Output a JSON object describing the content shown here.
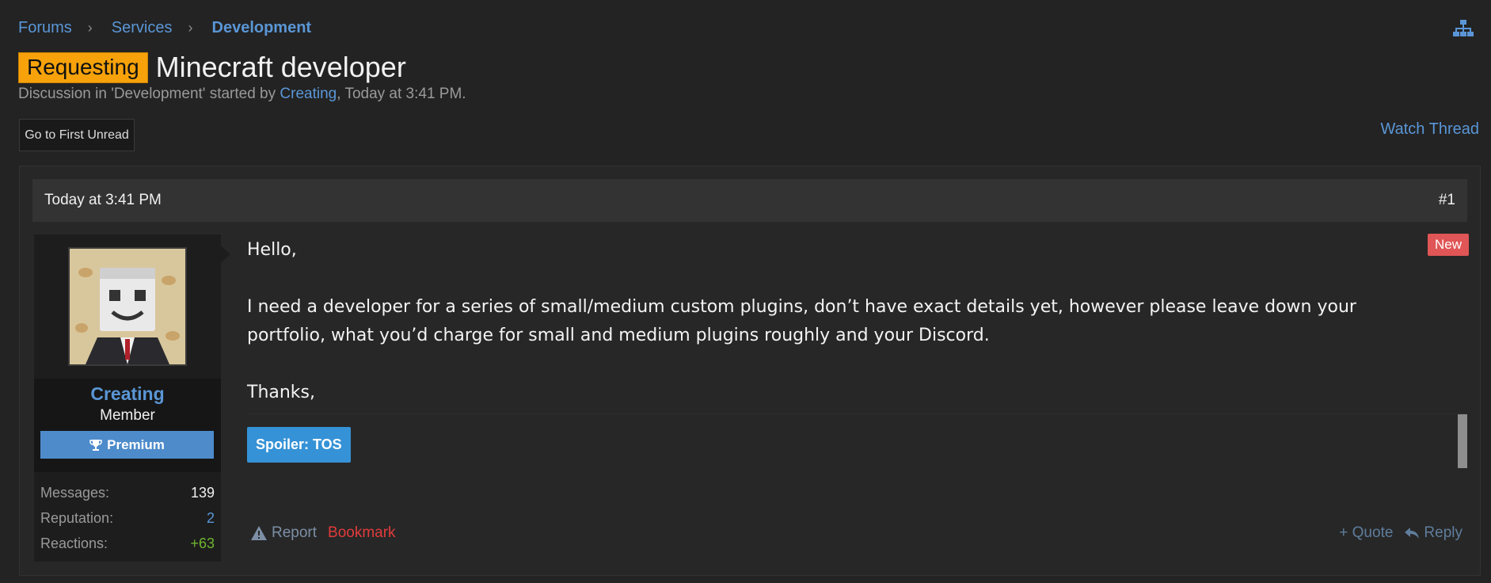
{
  "breadcrumb": {
    "items": [
      "Forums",
      "Services",
      "Development"
    ],
    "separator": "›"
  },
  "thread": {
    "prefix": "Requesting",
    "title": "Minecraft developer",
    "meta_prefix": "Discussion in 'Development' started by ",
    "meta_user": "Creating",
    "meta_suffix": ", Today at 3:41 PM."
  },
  "toolbar": {
    "first_unread": "Go to First Unread",
    "watch": "Watch Thread"
  },
  "post": {
    "date": "Today at 3:41 PM",
    "number": "#1",
    "new_badge": "New",
    "user": {
      "name": "Creating",
      "title": "Member",
      "banner": "Premium",
      "stats": [
        {
          "label": "Messages:",
          "value": "139"
        },
        {
          "label": "Reputation:",
          "value": "2"
        },
        {
          "label": "Reactions:",
          "value": "+63"
        }
      ]
    },
    "body": {
      "greeting": "Hello,",
      "paragraph": "I need a developer for a series of small/medium custom plugins, don’t have exact details yet, however please leave down your portfolio, what you’d charge for small and medium plugins roughly and your Discord.",
      "closing": "Thanks,"
    },
    "spoiler": "Spoiler: TOS",
    "actions": {
      "report": "Report",
      "bookmark": "Bookmark",
      "quote": "+ Quote",
      "reply": "Reply"
    }
  },
  "colors": {
    "background": "#232323",
    "link": "#5a96d6",
    "prefix": "#f7a20a",
    "new_badge": "#e05555",
    "bookmark": "#e23b3b",
    "reactions": "#6fb52f"
  }
}
